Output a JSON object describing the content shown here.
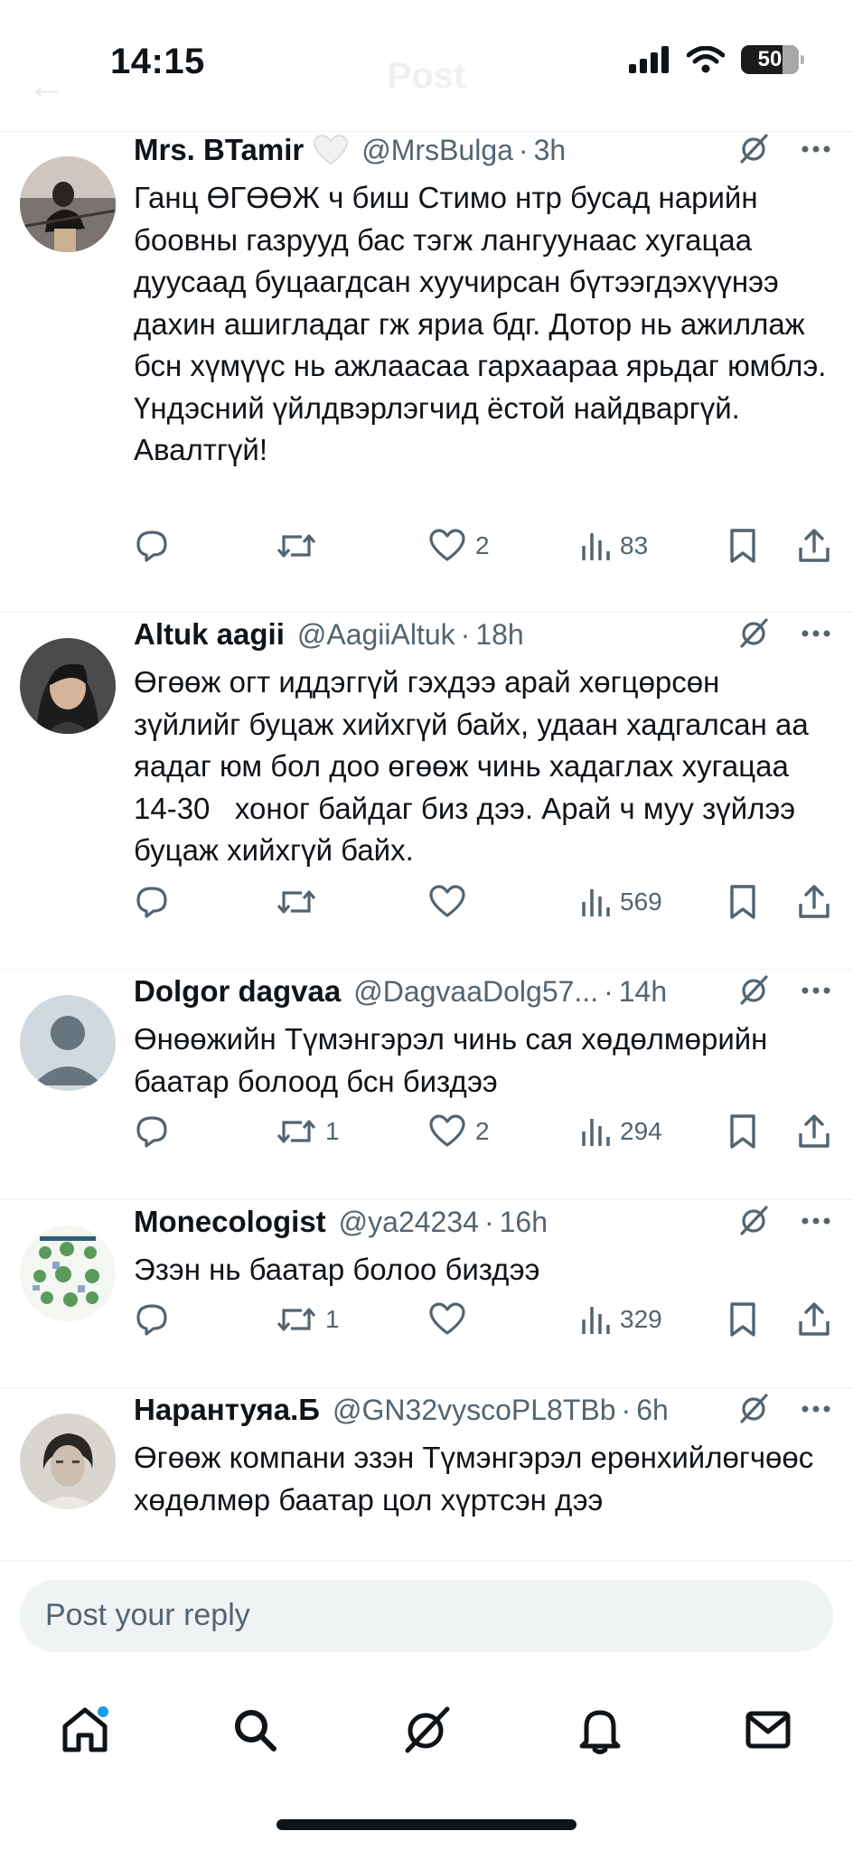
{
  "status_bar": {
    "time": "14:15",
    "battery": "50"
  },
  "header": {
    "title": "Post"
  },
  "replies": [
    {
      "name": "Mrs. BTamir",
      "handle": "@MrsBulga",
      "time": "3h",
      "text": "Ганц ӨГӨӨЖ ч биш Стимо нтр бусад нарийн боовны газрууд бас тэгж лангуунаас хугацаа дуусаад буцаагдсан хуучирсан бүтээгдэхүүнээ дахин ашигладаг гж яриа бдг. Дотор нь ажиллаж бсн хүмүүс нь ажлаасаа гархаараа ярьдаг юмблэ. Үндэсний үйлдвэрлэгчид ёстой найдваргүй. Авалтгүй!",
      "retweets": "",
      "likes": "2",
      "views": "83"
    },
    {
      "name": "Altuk aagii",
      "handle": "@AagiiAltuk",
      "time": "18h",
      "text": "Өгөөж огт иддэггүй гэхдээ арай хөгцөрсөн зүйлийг буцаж хийхгүй байх, удаан хадгалсан аа яадаг юм бол доо өгөөж чинь хадаглах хугацаа 14-30   хоног байдаг биз дээ. Арай ч муу зүйлээ буцаж хийхгүй байх.",
      "retweets": "",
      "likes": "",
      "views": "569"
    },
    {
      "name": "Dolgor dagvaa",
      "handle": "@DagvaaDolg57...",
      "time": "14h",
      "text": "Өнөөжийн Түмэнгэрэл чинь сая хөдөлмөрийн баатар болоод бсн биздээ",
      "retweets": "1",
      "likes": "2",
      "views": "294"
    },
    {
      "name": "Monecologist",
      "handle": "@ya24234",
      "time": "16h",
      "text": "Эзэн нь баатар болоо биздээ",
      "retweets": "1",
      "likes": "",
      "views": "329"
    },
    {
      "name": "Нарантуяа.Б",
      "handle": "@GN32vyscoPL8TBb",
      "time": "6h",
      "text": "Өгөөж компани эзэн Түмэнгэрэл ерөнхийлөгчөөс хөдөлмөр баатар цол хүртсэн дээ",
      "retweets": "",
      "likes": "",
      "views": ""
    }
  ],
  "compose": {
    "placeholder": "Post your reply"
  },
  "tabbar": {
    "items": [
      "home-icon",
      "search-icon",
      "grok-icon",
      "notifications-icon",
      "messages-icon"
    ]
  },
  "colors": {
    "text": "#0f1419",
    "secondary": "#536471",
    "accent": "#1d9bf0",
    "divider": "#eff3f4"
  }
}
